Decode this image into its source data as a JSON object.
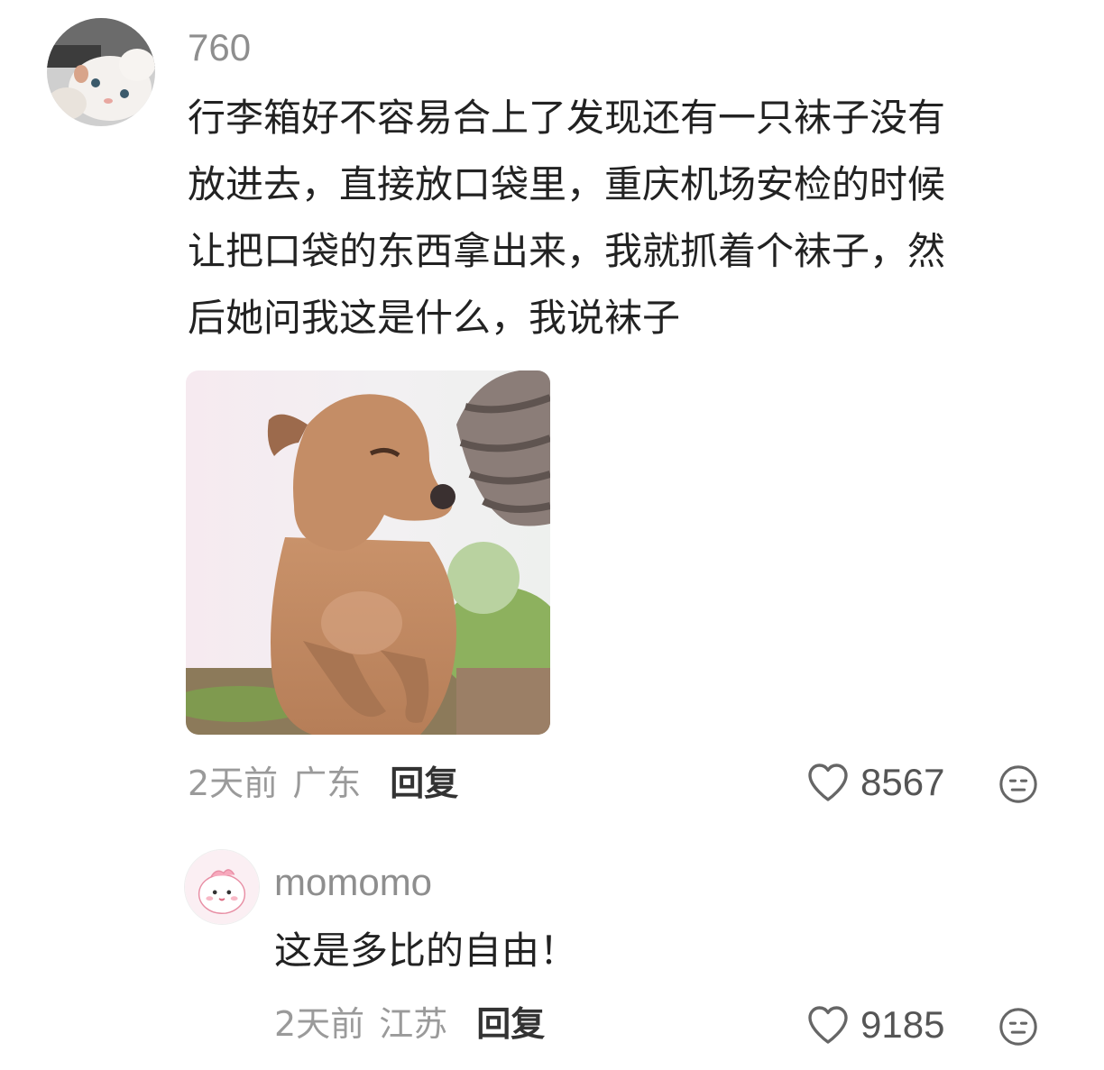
{
  "comment": {
    "username": "760",
    "text_lines": [
      "行李箱好不容易合上了发现还有一只袜子没有",
      "放进去，直接放口袋里，重庆机场安检的时候",
      "让把口袋的东西拿出来，我就抓着个袜子，然",
      "后她问我这是什么，我说袜子"
    ],
    "image_icon": "dog-meme-image",
    "time": "2天前",
    "location": "广东",
    "reply_label": "回复",
    "likes": "8567"
  },
  "reply": {
    "username": "momomo",
    "text": "这是多比的自由！",
    "time": "2天前",
    "location": "江苏",
    "reply_label": "回复",
    "likes": "9185"
  },
  "colors": {
    "username": "#8e8e8e",
    "text": "#222222",
    "meta": "#9a9a9a",
    "reply": "#333333"
  },
  "icons": [
    "cat-avatar",
    "pink-cartoon-avatar",
    "heart-icon",
    "reaction-face-icon"
  ]
}
